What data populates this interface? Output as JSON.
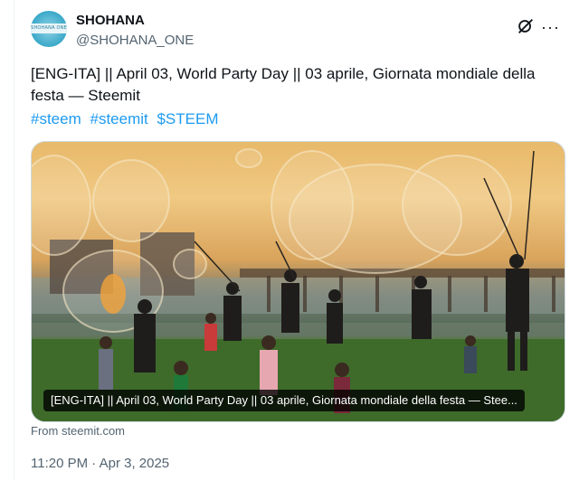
{
  "author": {
    "name": "SHOHANA",
    "handle": "@SHOHANA_ONE",
    "avatar_text": "SHOHANA ONE"
  },
  "icons": {
    "grok": "grok-icon",
    "more": "more-options-icon"
  },
  "tweet": {
    "text": "[ENG-ITA] || April 03, World Party Day  || 03 aprile, Giornata mondiale della festa — Steemit",
    "hashtags": [
      "#steem",
      "#steemit",
      "$STEEM"
    ]
  },
  "card": {
    "caption": "[ENG-ITA] || April 03, World Party Day || 03 aprile, Giornata mondiale della festa — Stee...",
    "source": "From steemit.com"
  },
  "timestamp": "11:20 PM · Apr 3, 2025",
  "colors": {
    "link": "#1d9bf0",
    "secondary_text": "#536471",
    "primary_text": "#0f1419"
  }
}
